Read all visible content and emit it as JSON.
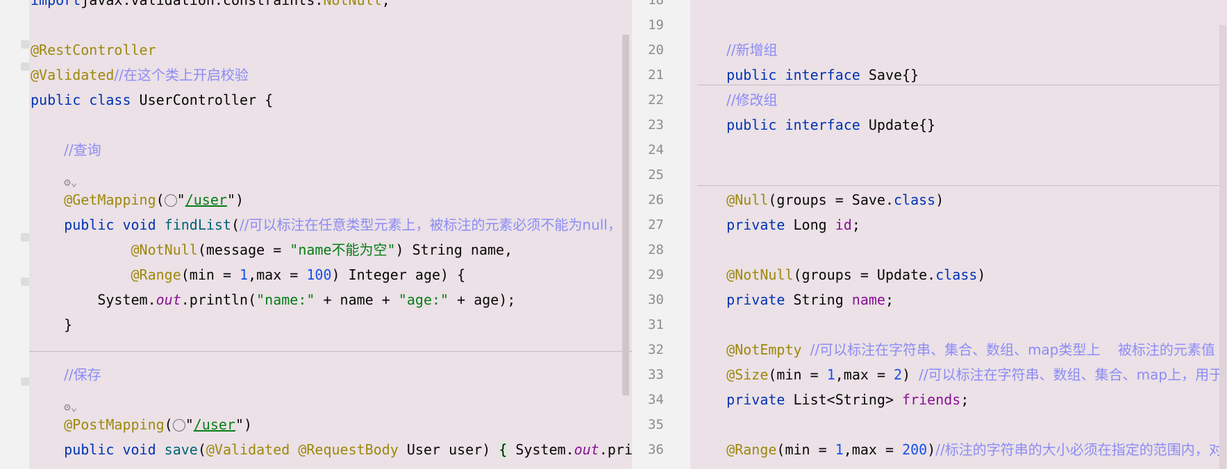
{
  "left": {
    "lines": [
      {
        "parts": [
          [
            "kw",
            "import"
          ],
          [
            "",
            "javax.validation.constraints."
          ],
          [
            "an",
            "NotNull"
          ],
          [
            "",
            ";"
          ]
        ]
      },
      {
        "parts": []
      },
      {
        "parts": [
          [
            "an",
            "@RestController"
          ]
        ]
      },
      {
        "parts": [
          [
            "an",
            "@Validated"
          ],
          [
            "cm",
            "//在这个类上开启校验"
          ]
        ]
      },
      {
        "parts": [
          [
            "kw",
            "public class"
          ],
          [
            "",
            " UserController {"
          ]
        ]
      },
      {
        "parts": []
      },
      {
        "parts": [
          [
            "",
            ""
          ],
          [
            "cm",
            "//查询"
          ]
        ],
        "indent": "    "
      },
      {
        "parts": [],
        "bean": true
      },
      {
        "parts": [
          [
            "an",
            "@GetMapping"
          ],
          [
            "",
            "("
          ],
          [
            "globe",
            ""
          ],
          [
            "",
            "\""
          ],
          [
            "url",
            "/user"
          ],
          [
            "",
            "\")"
          ]
        ],
        "indent": "    "
      },
      {
        "parts": [
          [
            "kw",
            "public void "
          ],
          [
            "fn",
            "findList"
          ],
          [
            "",
            "("
          ],
          [
            "cm",
            "//可以标注在任意类型元素上，被标注的元素必须不能为null，"
          ]
        ],
        "indent": "    "
      },
      {
        "parts": [
          [
            "an",
            "@NotNull"
          ],
          [
            "",
            "(message = "
          ],
          [
            "st",
            "\"name不能为空\""
          ],
          [
            "",
            ") String name,"
          ]
        ],
        "indent": "            "
      },
      {
        "parts": [
          [
            "an",
            "@Range"
          ],
          [
            "",
            "(min = "
          ],
          [
            "nm",
            "1"
          ],
          [
            "",
            ",max = "
          ],
          [
            "nm",
            "100"
          ],
          [
            "",
            ") Integer age) {"
          ]
        ],
        "indent": "            "
      },
      {
        "parts": [
          [
            "",
            "System."
          ],
          [
            "sf",
            "out"
          ],
          [
            "",
            ".println("
          ],
          [
            "st",
            "\"name:\""
          ],
          [
            "",
            " + name + "
          ],
          [
            "st",
            "\"age:\""
          ],
          [
            "",
            " + age);"
          ]
        ],
        "indent": "        "
      },
      {
        "parts": [
          [
            "",
            "}"
          ]
        ],
        "indent": "    "
      },
      {
        "parts": []
      },
      {
        "parts": [
          [
            "cm",
            "//保存"
          ]
        ],
        "indent": "    "
      },
      {
        "parts": [],
        "bean": true
      },
      {
        "parts": [
          [
            "an",
            "@PostMapping"
          ],
          [
            "",
            "("
          ],
          [
            "globe",
            ""
          ],
          [
            "",
            "\""
          ],
          [
            "url",
            "/user"
          ],
          [
            "",
            "\")"
          ]
        ],
        "indent": "    "
      },
      {
        "parts": [
          [
            "kw",
            "public void "
          ],
          [
            "fn",
            "save"
          ],
          [
            "",
            "("
          ],
          [
            "an",
            "@Validated @RequestBody"
          ],
          [
            "",
            " User user) "
          ],
          [
            "hl",
            "{"
          ],
          [
            "",
            " System."
          ],
          [
            "sf",
            "out"
          ],
          [
            "",
            ".pri"
          ]
        ],
        "indent": "    "
      }
    ]
  },
  "right": {
    "line_numbers": [
      "18",
      "19",
      "20",
      "21",
      "22",
      "23",
      "24",
      "25",
      "26",
      "27",
      "28",
      "29",
      "30",
      "31",
      "32",
      "33",
      "34",
      "35",
      "36"
    ],
    "lines": [
      {
        "parts": []
      },
      {
        "parts": []
      },
      {
        "parts": [
          [
            "cm",
            "//新增组"
          ]
        ],
        "indent": "    "
      },
      {
        "parts": [
          [
            "kw",
            "public interface"
          ],
          [
            "",
            " Save{}"
          ]
        ],
        "indent": "    "
      },
      {
        "parts": [
          [
            "cm",
            "//修改组"
          ]
        ],
        "indent": "    "
      },
      {
        "parts": [
          [
            "kw",
            "public interface"
          ],
          [
            "",
            " Update{}"
          ]
        ],
        "indent": "    "
      },
      {
        "parts": []
      },
      {
        "parts": []
      },
      {
        "parts": [
          [
            "an",
            "@Null"
          ],
          [
            "",
            "(groups = Save."
          ],
          [
            "kw",
            "class"
          ],
          [
            "",
            ")"
          ]
        ],
        "indent": "    "
      },
      {
        "parts": [
          [
            "kw",
            "private"
          ],
          [
            "",
            " Long "
          ],
          [
            "fld",
            "id"
          ],
          [
            "",
            ";"
          ]
        ],
        "indent": "    "
      },
      {
        "parts": []
      },
      {
        "parts": [
          [
            "an",
            "@NotNull"
          ],
          [
            "",
            "(groups = Update."
          ],
          [
            "kw",
            "class"
          ],
          [
            "",
            ")"
          ]
        ],
        "indent": "    "
      },
      {
        "parts": [
          [
            "kw",
            "private"
          ],
          [
            "",
            " String "
          ],
          [
            "fld",
            "name"
          ],
          [
            "",
            ";"
          ]
        ],
        "indent": "    "
      },
      {
        "parts": []
      },
      {
        "parts": [
          [
            "an",
            "@NotEmpty"
          ],
          [
            "",
            " "
          ],
          [
            "cm",
            "//可以标注在字符串、集合、数组、map类型上    被标注的元素值"
          ]
        ],
        "indent": "    "
      },
      {
        "parts": [
          [
            "an",
            "@Size"
          ],
          [
            "",
            "(min = "
          ],
          [
            "nm",
            "1"
          ],
          [
            "",
            ",max = "
          ],
          [
            "nm",
            "2"
          ],
          [
            "",
            ") "
          ],
          [
            "cm",
            "//可以标注在字符串、数组、集合、map上，用于"
          ]
        ],
        "indent": "    "
      },
      {
        "parts": [
          [
            "kw",
            "private"
          ],
          [
            "",
            " List<String> "
          ],
          [
            "fld",
            "friends"
          ],
          [
            "",
            ";"
          ]
        ],
        "indent": "    "
      },
      {
        "parts": []
      },
      {
        "parts": [
          [
            "an",
            "@Range"
          ],
          [
            "",
            "(min = "
          ],
          [
            "nm",
            "1"
          ],
          [
            "",
            ",max = "
          ],
          [
            "nm",
            "200"
          ],
          [
            "",
            ")"
          ],
          [
            "cm",
            "//标注的字符串的大小必须在指定的范围内，对"
          ]
        ],
        "indent": "    "
      }
    ]
  }
}
